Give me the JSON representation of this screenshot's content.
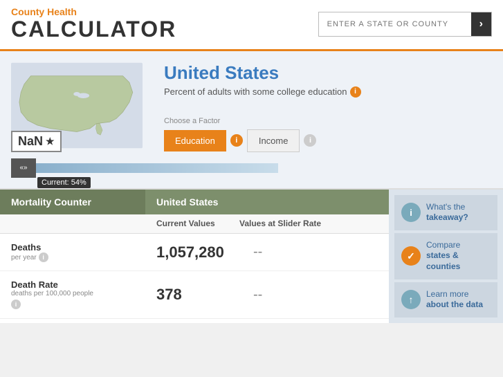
{
  "header": {
    "logo_top": "County Health",
    "logo_bottom": "CALCULATOR",
    "search_placeholder": "ENTER A STATE OR COUNTY",
    "search_btn_icon": "›"
  },
  "location": {
    "title": "United States",
    "subtitle": "Percent of adults with some college education",
    "nan_label": "NaN"
  },
  "slider": {
    "current_label": "Current: 54%",
    "btn_label": "«»"
  },
  "factors": {
    "label": "Choose a Factor",
    "items": [
      {
        "id": "education",
        "label": "Education",
        "active": true
      },
      {
        "id": "income",
        "label": "Income",
        "active": false
      }
    ]
  },
  "table": {
    "header_left": "Mortality Counter",
    "header_right": "United States",
    "col1": "Current Values",
    "col2": "Values at Slider Rate",
    "rows": [
      {
        "label": "Deaths",
        "sublabel": "per year",
        "value": "1,057,280",
        "slider_value": "--"
      },
      {
        "label": "Death Rate",
        "sublabel": "deaths per 100,000 people",
        "value": "378",
        "slider_value": "--"
      }
    ]
  },
  "sidebar": {
    "cards": [
      {
        "id": "takeaway",
        "icon": "i",
        "icon_class": "icon-info",
        "line1": "What's the",
        "line2": "takeaway?"
      },
      {
        "id": "compare",
        "icon": "✓",
        "icon_class": "icon-check",
        "line1": "Compare",
        "line2": "states & counties"
      },
      {
        "id": "learn",
        "icon": "↑",
        "icon_class": "icon-chart",
        "line1": "Learn more",
        "line2": "about the data"
      }
    ]
  }
}
